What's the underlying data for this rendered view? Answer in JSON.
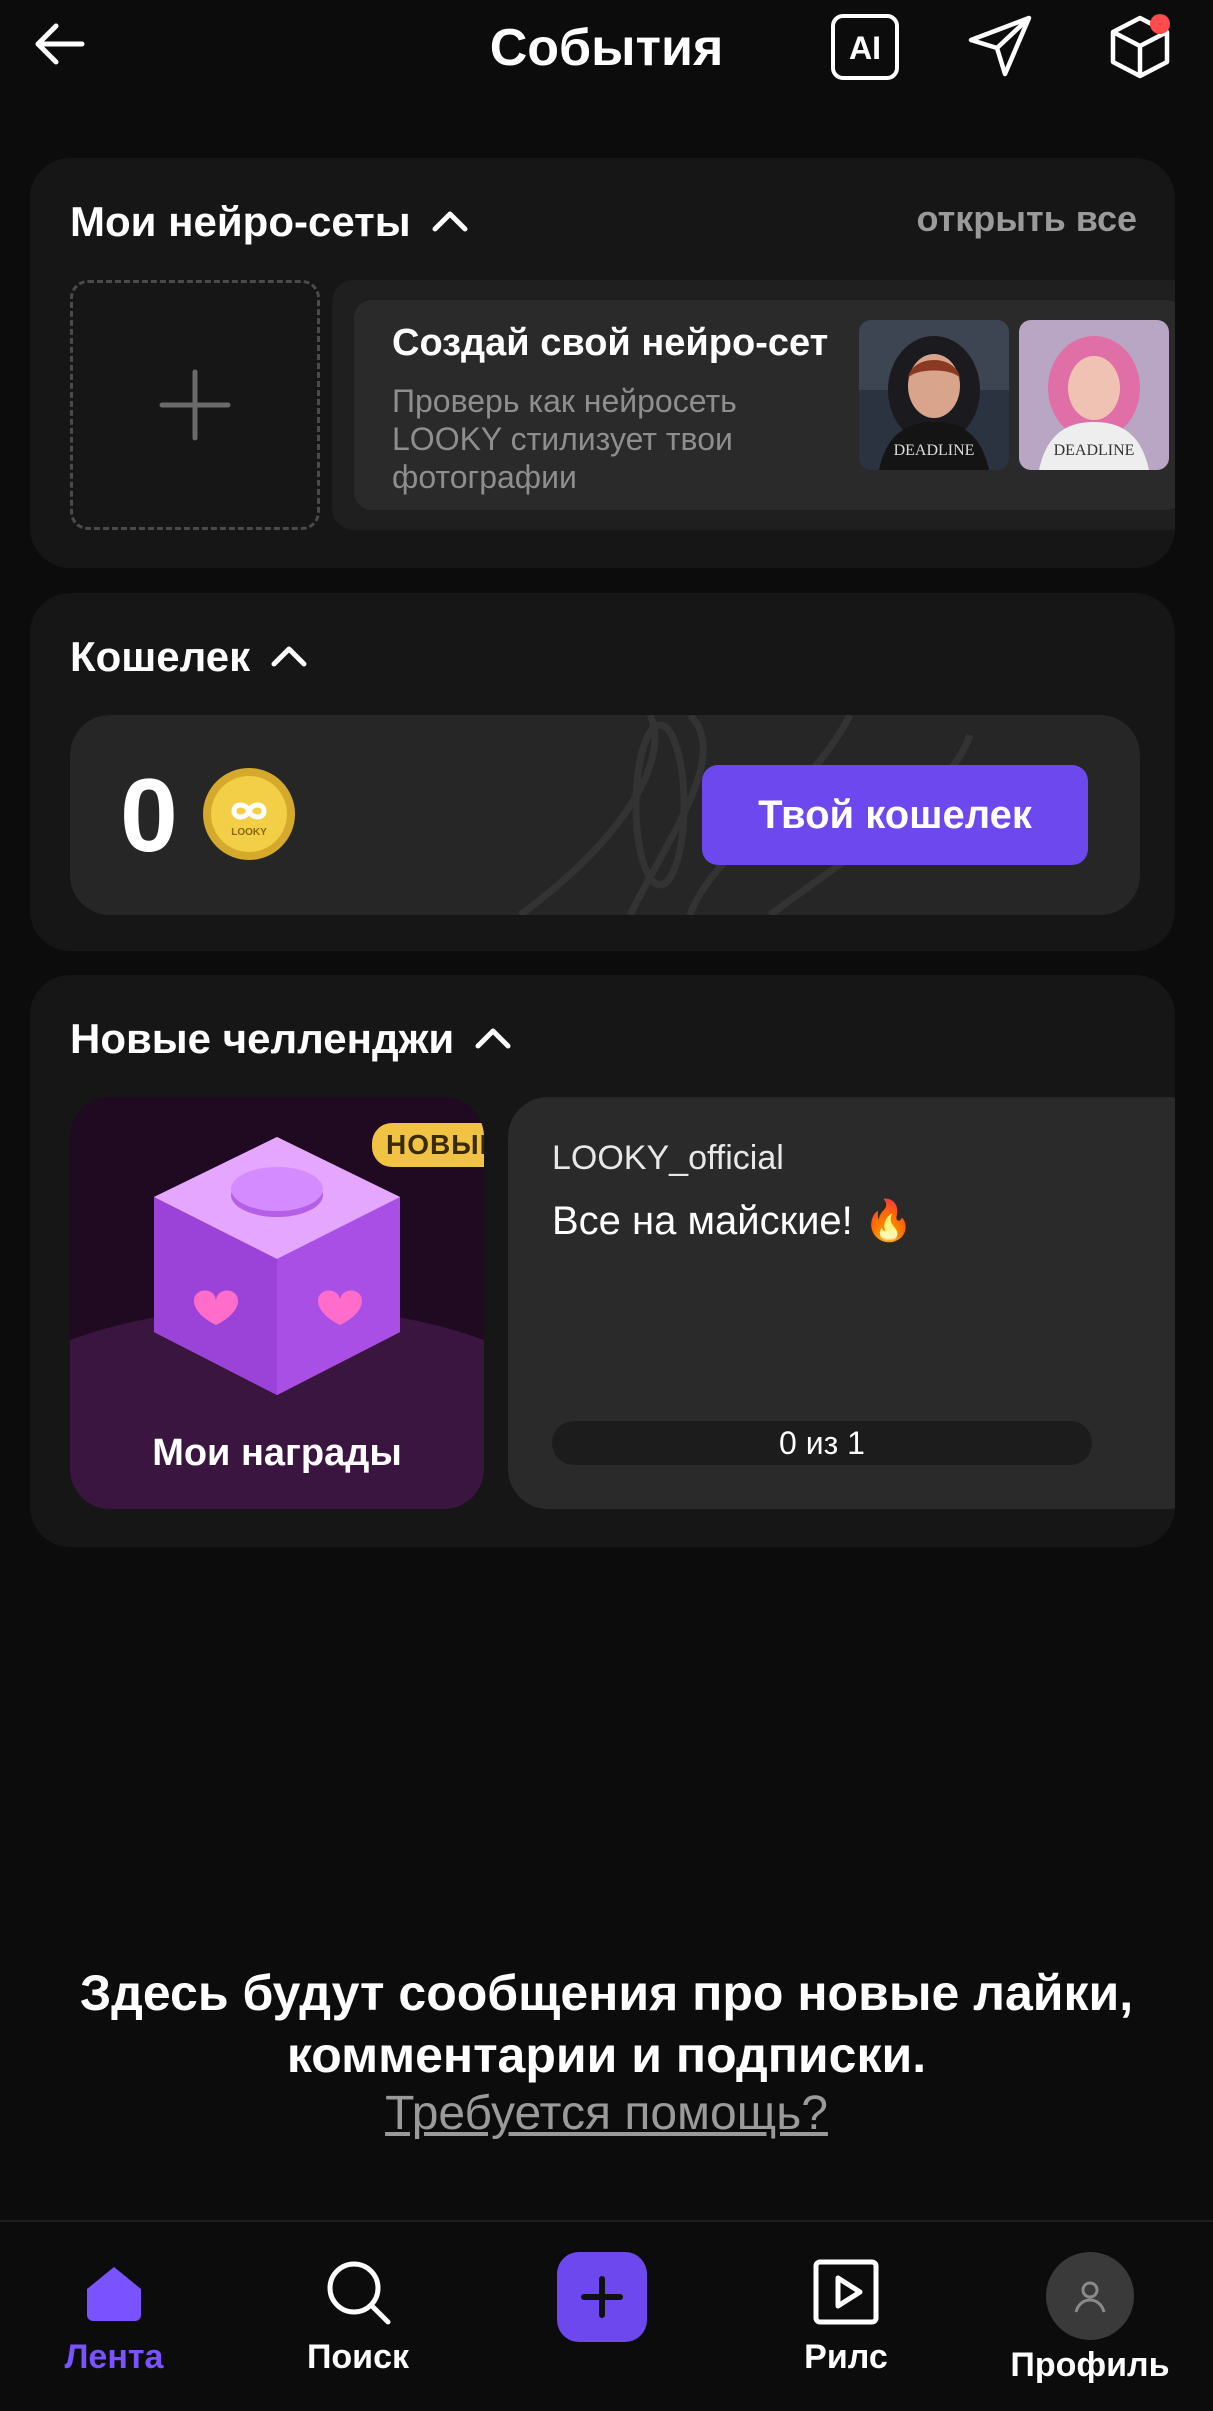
{
  "header": {
    "title": "События",
    "ai_label": "AI"
  },
  "neuro": {
    "title": "Мои нейро-сеты",
    "open_all": "открыть все",
    "promo_title": "Создай свой нейро-сет",
    "promo_text": "Проверь как нейросеть LOOKY стилизует твои фотографии",
    "thumb_caption": "DEADLINE"
  },
  "wallet": {
    "title": "Кошелек",
    "amount": "0",
    "coin_label": "LOOKY",
    "button": "Твой кошелек"
  },
  "challenges": {
    "title": "Новые челленджи",
    "rewards_label": "Мои награды",
    "new_badge": "НОВЫЙ",
    "card": {
      "author": "LOOKY_official",
      "title": "Все на майские! 🔥",
      "progress": "0 из 1"
    }
  },
  "empty_state": {
    "line1": "Здесь будут сообщения про новые лайки,",
    "line2": "комментарии и подписки.",
    "help": "Требуется помощь?"
  },
  "nav": {
    "feed": "Лента",
    "search": "Поиск",
    "reels": "Рилс",
    "profile": "Профиль"
  },
  "colors": {
    "accent": "#6d48ef",
    "nav_active": "#7a52ff",
    "badge": "#f0c344",
    "notification_dot": "#ff4b4b",
    "background": "#0c0c0c"
  }
}
